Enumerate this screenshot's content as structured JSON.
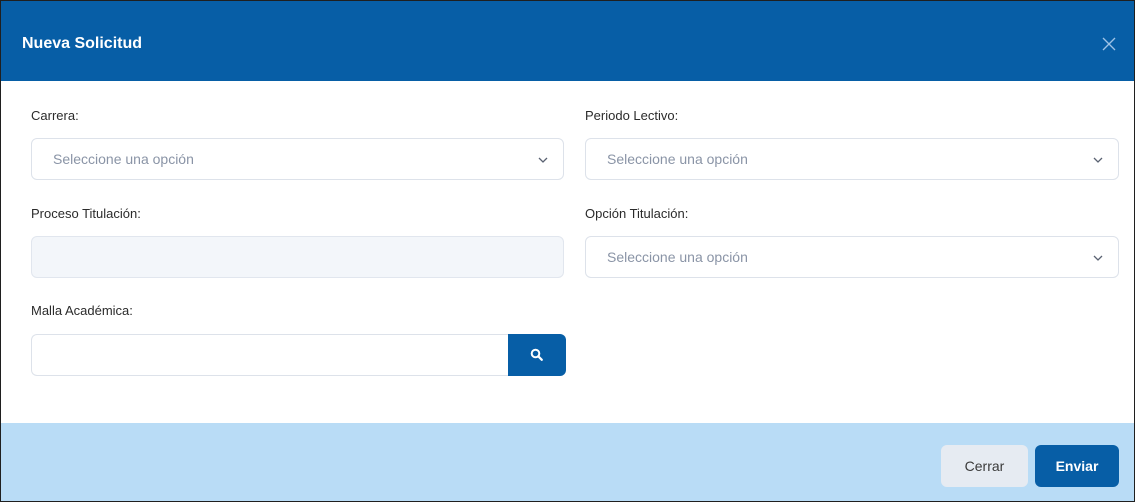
{
  "modal": {
    "title": "Nueva Solicitud",
    "close_icon": "close-icon"
  },
  "form": {
    "carrera": {
      "label": "Carrera:",
      "placeholder": "Seleccione una opción"
    },
    "periodo_lectivo": {
      "label": "Periodo Lectivo:",
      "placeholder": "Seleccione una opción"
    },
    "proceso_titulacion": {
      "label": "Proceso Titulación:",
      "value": ""
    },
    "opcion_titulacion": {
      "label": "Opción Titulación:",
      "placeholder": "Seleccione una opción"
    },
    "malla_academica": {
      "label": "Malla Académica:",
      "value": "",
      "search_icon": "search-icon"
    }
  },
  "footer": {
    "close_label": "Cerrar",
    "submit_label": "Enviar"
  },
  "colors": {
    "primary": "#075ea6",
    "footer_bg": "#b9dcf6",
    "disabled_bg": "#f3f6fa",
    "secondary_btn": "#e6ebf2"
  }
}
